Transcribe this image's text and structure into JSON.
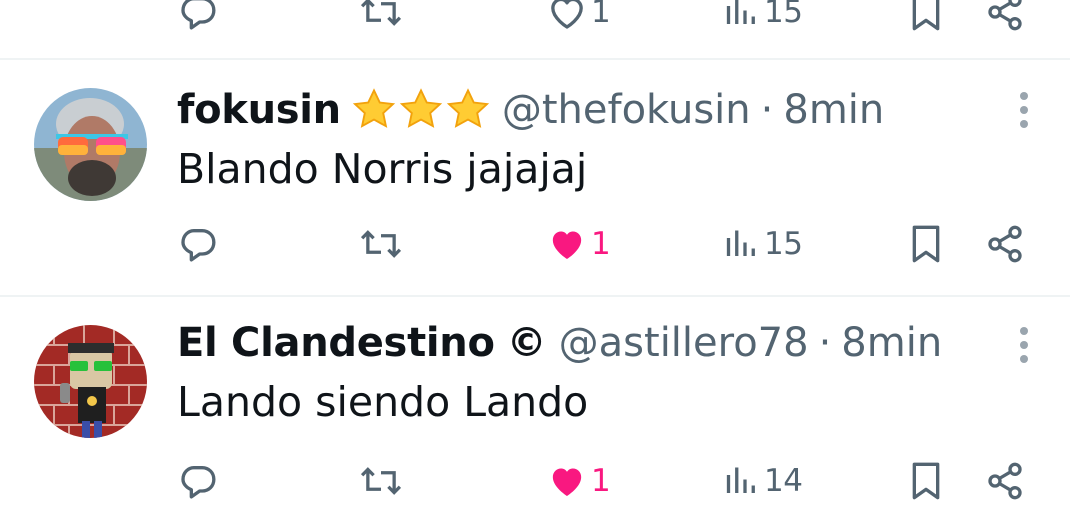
{
  "top_actions": {
    "like_count": "1",
    "view_count": "15"
  },
  "tweets": [
    {
      "display_name": "fokusin",
      "handle": "@thefokusin",
      "separator": "·",
      "time": "8min",
      "text": "Blando Norris jajajaj",
      "likes": "1",
      "views": "15",
      "liked": true,
      "name_badges": [
        "star-emoji",
        "star-emoji",
        "star-emoji"
      ]
    },
    {
      "display_name": "El Clandestino",
      "name_suffix": "©",
      "handle": "@astillero78",
      "separator": "·",
      "time": "8min",
      "text": "Lando siendo Lando",
      "likes": "1",
      "views": "14",
      "liked": true
    }
  ],
  "icons": {
    "reply": "reply-icon",
    "retweet": "retweet-icon",
    "like": "heart-icon",
    "views": "views-icon",
    "bookmark": "bookmark-icon",
    "share": "share-icon",
    "more": "more-vertical-icon"
  },
  "colors": {
    "text_primary": "#0f1419",
    "text_secondary": "#536471",
    "like_active": "#f91880",
    "divider": "#eff3f4"
  }
}
